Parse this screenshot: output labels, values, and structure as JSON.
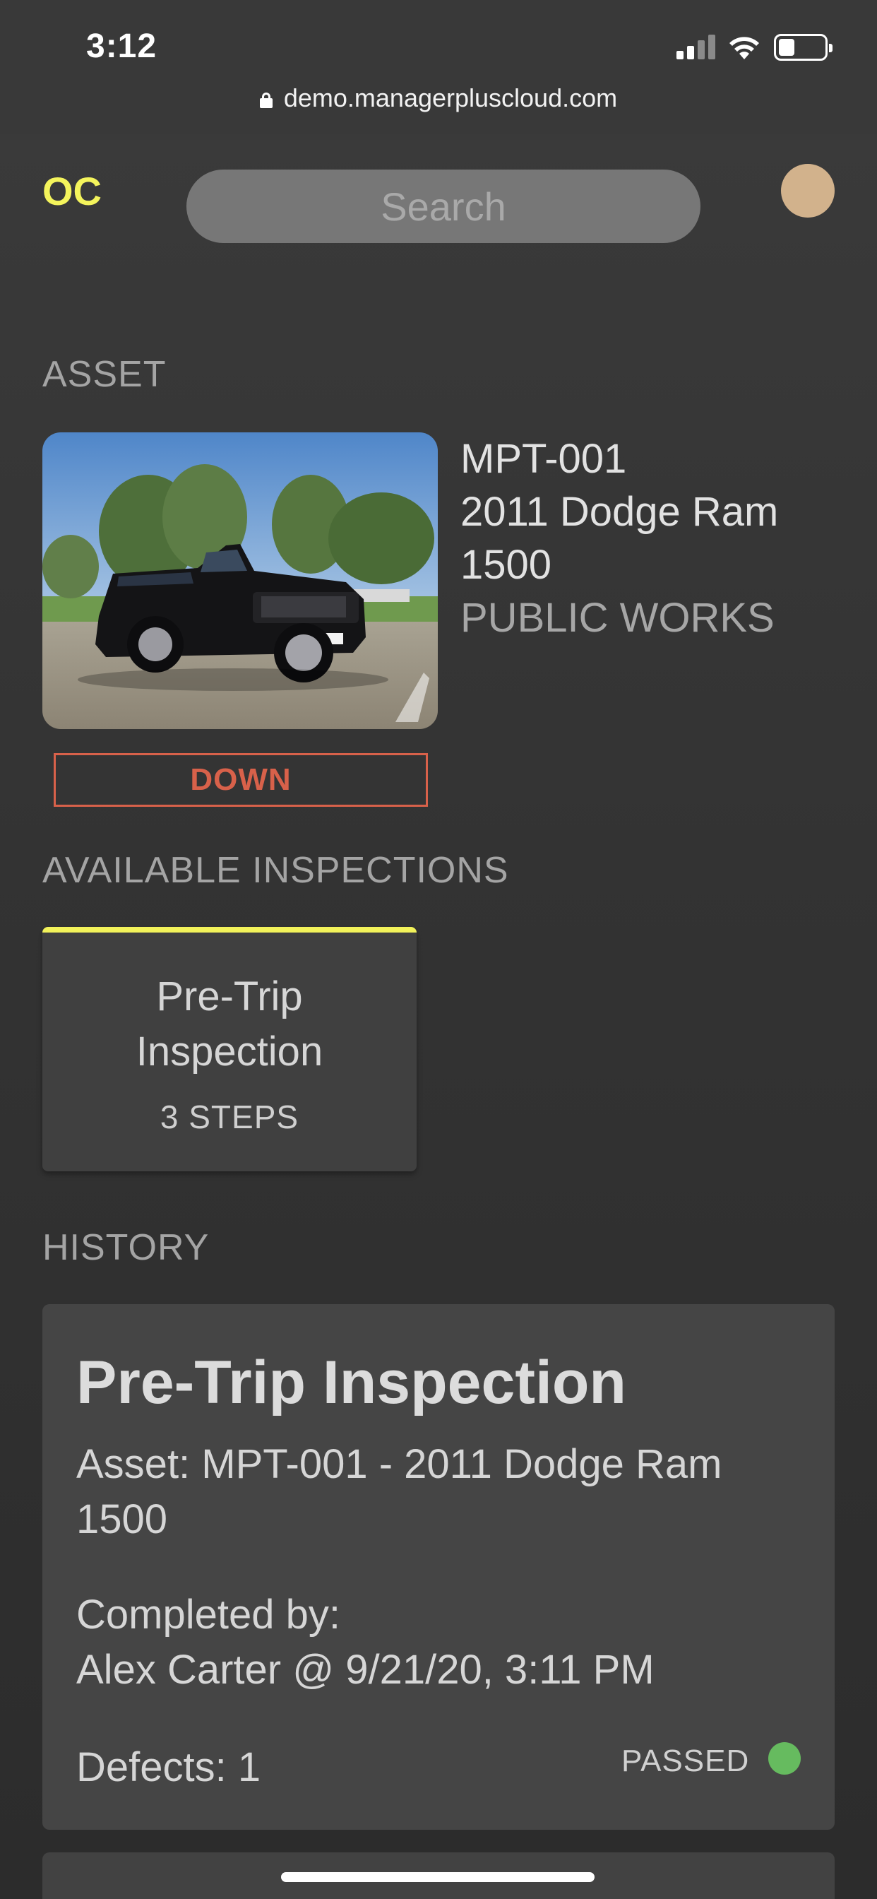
{
  "status_bar": {
    "time": "3:12"
  },
  "browser": {
    "url": "demo.managerpluscloud.com"
  },
  "header": {
    "logo": "OC",
    "search_placeholder": "Search"
  },
  "asset": {
    "section_label": "ASSET",
    "id": "MPT-001",
    "name": "2011 Dodge Ram 1500",
    "department": "PUBLIC WORKS",
    "status": "DOWN"
  },
  "inspections": {
    "section_label": "AVAILABLE INSPECTIONS",
    "items": [
      {
        "title": "Pre-Trip Inspection",
        "steps": "3 STEPS"
      }
    ]
  },
  "history": {
    "section_label": "HISTORY",
    "items": [
      {
        "title": "Pre-Trip Inspection",
        "asset": "Asset: MPT-001 - 2011 Dodge Ram 1500",
        "completed_label": "Completed by:",
        "completed_by": "Alex Carter @ 9/21/20, 3:11 PM",
        "defects": "Defects: 1",
        "result": "PASSED"
      }
    ]
  },
  "colors": {
    "accent_yellow": "#f2f25a",
    "status_down": "#d8614a",
    "passed_green": "#66bb5f"
  }
}
